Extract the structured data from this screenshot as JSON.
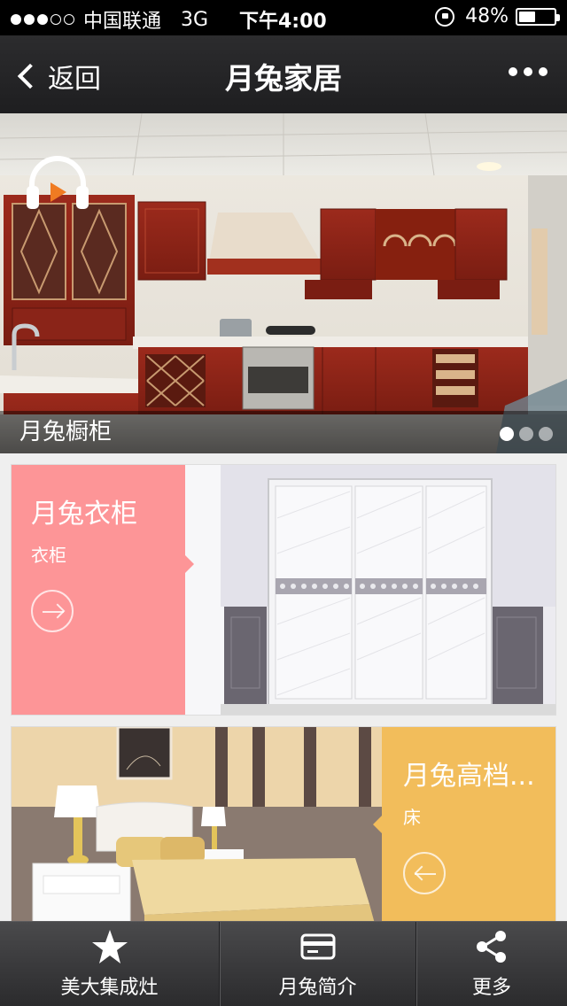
{
  "status_bar": {
    "carrier": "中国联通",
    "network": "3G",
    "time": "下午4:00",
    "battery_percent_text": "48%",
    "battery_level": 0.48
  },
  "nav": {
    "back_label": "返回",
    "title": "月兔家居"
  },
  "hero": {
    "caption": "月兔橱柜",
    "slide_count": 3,
    "active_slide": 0
  },
  "cards": [
    {
      "title": "月兔衣柜",
      "subtitle": "衣柜",
      "panel_color": "#fd9597",
      "arrow": "arrow-right-icon"
    },
    {
      "title": "月兔高档...",
      "subtitle": "床",
      "panel_color": "#f2bd5b",
      "arrow": "arrow-left-icon"
    }
  ],
  "tab_bar": {
    "items": [
      {
        "label": "美大集成灶",
        "icon": "star-icon"
      },
      {
        "label": "月兔简介",
        "icon": "card-icon"
      },
      {
        "label": "更多",
        "icon": "share-icon"
      }
    ]
  }
}
